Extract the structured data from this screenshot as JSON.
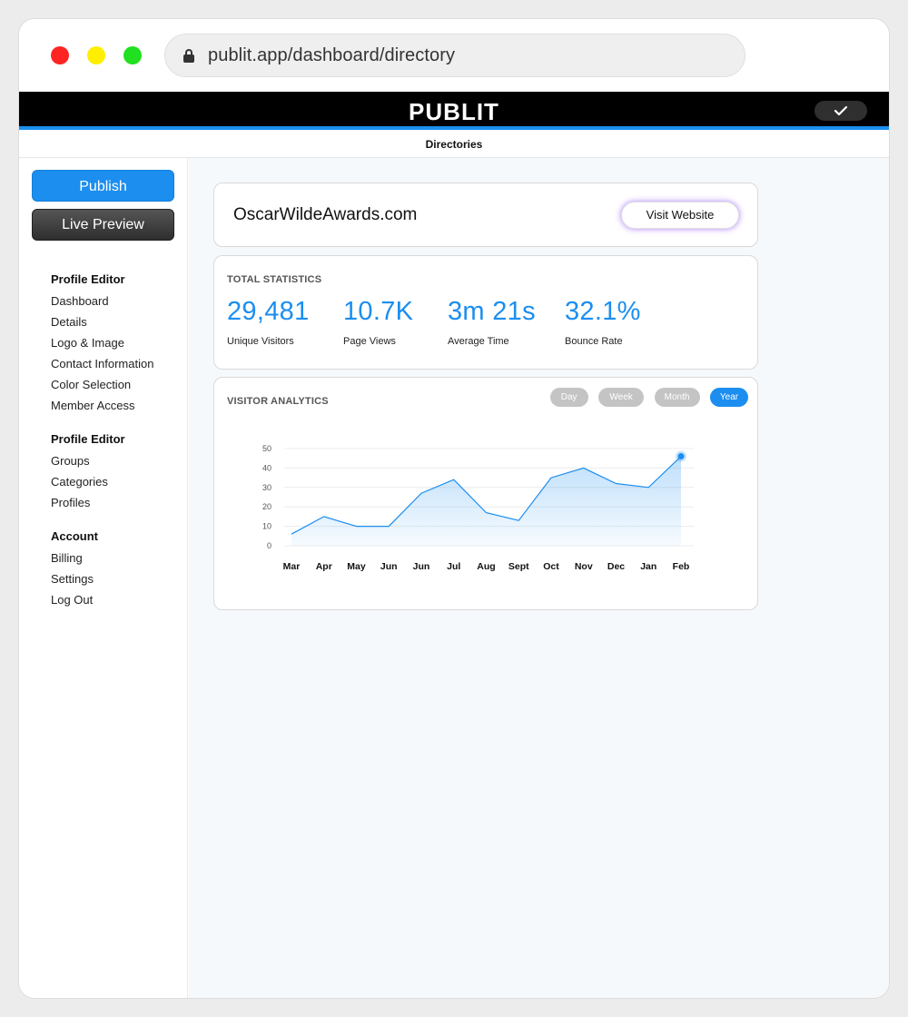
{
  "browser": {
    "url": "publit.app/dashboard/directory"
  },
  "app": {
    "brand": "PUBLIT",
    "subnav_title": "Directories"
  },
  "sidebar": {
    "publish_label": "Publish",
    "preview_label": "Live Preview",
    "groups": [
      {
        "heading": "Profile Editor",
        "items": [
          "Dashboard",
          "Details",
          "Logo & Image",
          "Contact Information",
          "Color Selection",
          "Member Access"
        ]
      },
      {
        "heading": "Profile Editor",
        "items": [
          "Groups",
          "Categories",
          "Profiles"
        ]
      },
      {
        "heading": "Account",
        "items": [
          "Billing",
          "Settings",
          "Log Out"
        ]
      }
    ]
  },
  "site": {
    "name": "OscarWildeAwards.com",
    "visit_label": "Visit Website"
  },
  "stats": {
    "section_label": "TOTAL STATISTICS",
    "items": [
      {
        "value": "29,481",
        "label": "Unique Visitors"
      },
      {
        "value": "10.7K",
        "label": "Page Views"
      },
      {
        "value": "3m 21s",
        "label": "Average Time"
      },
      {
        "value": "32.1%",
        "label": "Bounce Rate"
      }
    ]
  },
  "analytics": {
    "section_label": "VISITOR ANALYTICS",
    "ranges": [
      "Day",
      "Week",
      "Month",
      "Year"
    ],
    "active_range": "Year"
  },
  "colors": {
    "accent": "#1b8ef0",
    "pill_inactive": "#c4c4c4",
    "header_bg": "#000000"
  },
  "chart_data": {
    "type": "area",
    "title": "",
    "xlabel": "",
    "ylabel": "",
    "categories": [
      "Mar",
      "Apr",
      "May",
      "Jun",
      "Jun",
      "Jul",
      "Aug",
      "Sept",
      "Oct",
      "Nov",
      "Dec",
      "Jan",
      "Feb"
    ],
    "series": [
      {
        "values": [
          6,
          15,
          10,
          10,
          27,
          34,
          17,
          13,
          35,
          40,
          32,
          30,
          46
        ]
      }
    ],
    "yticks": [
      0,
      10,
      20,
      30,
      40,
      50
    ],
    "ylim": [
      0,
      50
    ],
    "grid": true,
    "highlight_last_point": true,
    "color": "#1b8ef0"
  }
}
